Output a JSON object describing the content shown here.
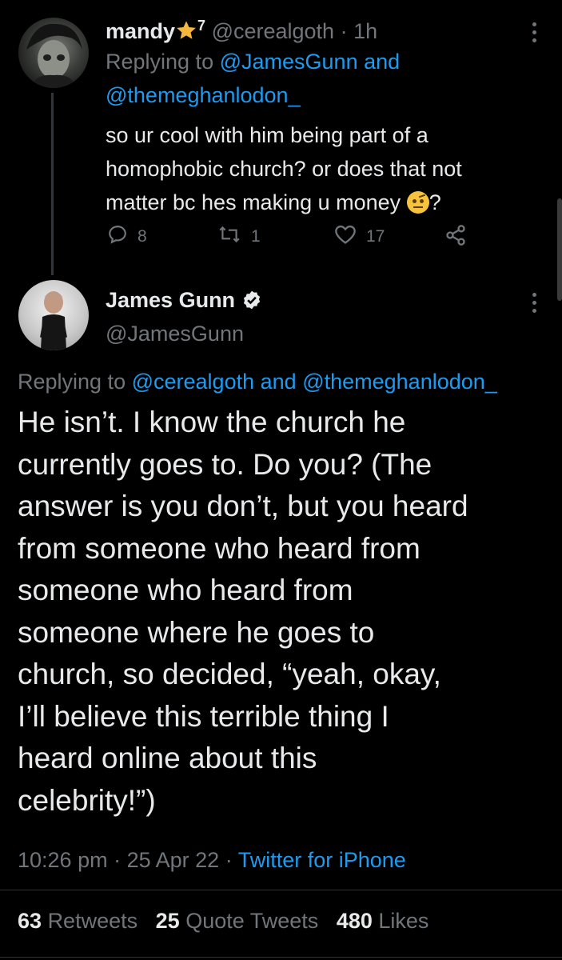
{
  "colors": {
    "background": "#000000",
    "text": "#e7e9ea",
    "muted": "#71767b",
    "link": "#1d9bf0"
  },
  "reply_tweet": {
    "display_name": "mandy",
    "name_badge_icon": "star-icon",
    "name_superscript": "7",
    "handle": "@cerealgoth",
    "separator": "·",
    "time_ago": "1h",
    "replying_prefix": "Replying to",
    "replying_user_1": "@JamesGunn",
    "replying_and": "and",
    "replying_user_2": "@themeghanlodon_",
    "body_lines": [
      "so ur cool with him being part of a",
      "homophobic church? or does that not",
      "matter bc hes making u money"
    ],
    "body_end": "?",
    "emoji_icon": "face-with-raised-eyebrow-emoji",
    "replies": "8",
    "retweets": "1",
    "likes": "17"
  },
  "main_tweet": {
    "display_name": "James Gunn",
    "verified_icon": "verified-badge-icon",
    "handle": "@JamesGunn",
    "replying_prefix": "Replying to",
    "replying_user_1": "@cerealgoth",
    "replying_and": "and",
    "replying_user_2": "@themeghanlodon_",
    "body_lines": [
      "He isn’t. I know the church he",
      "currently goes to. Do you? (The",
      "answer is you don’t, but you heard",
      "from someone who heard from",
      "someone who heard from",
      "someone where he goes to",
      "church, so decided, “yeah, okay,",
      "I’ll believe this terrible thing I",
      "heard online about this",
      "celebrity!”)"
    ],
    "time": "10:26 pm",
    "date": "25 Apr 22",
    "source": "Twitter for iPhone",
    "retweet_count": "63",
    "retweet_label": "Retweets",
    "quote_count": "25",
    "quote_label": "Quote Tweets",
    "like_count": "480",
    "like_label": "Likes"
  }
}
